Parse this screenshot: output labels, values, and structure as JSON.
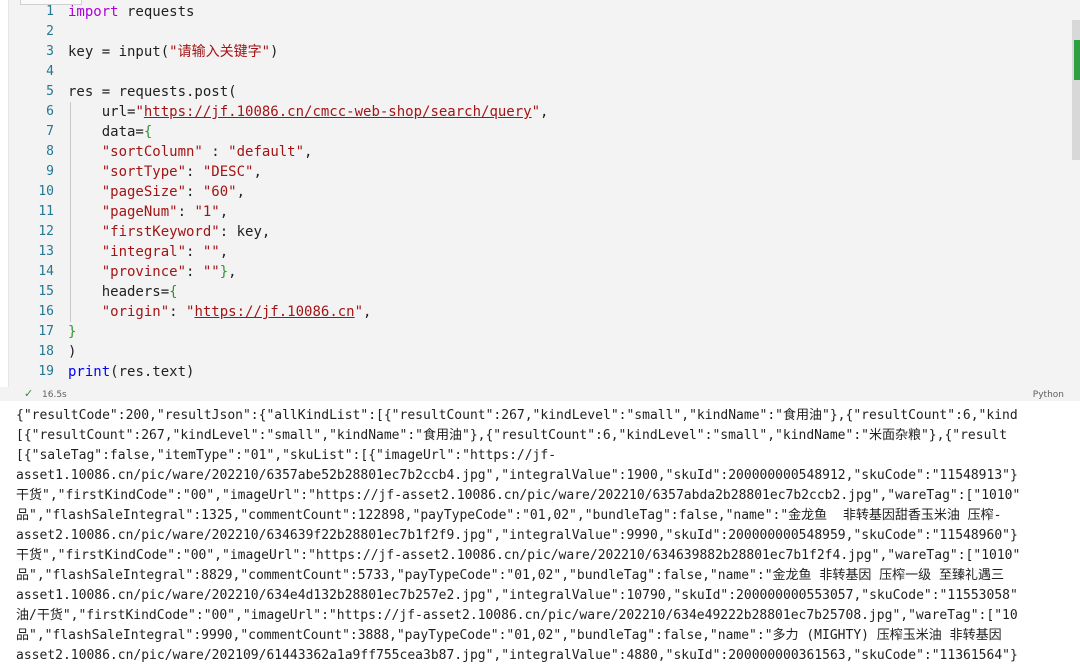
{
  "code_lines": [
    {
      "n": "1",
      "tokens": [
        {
          "t": "import",
          "c": "kw2"
        },
        {
          "t": " requests",
          "c": ""
        }
      ]
    },
    {
      "n": "2",
      "tokens": []
    },
    {
      "n": "3",
      "tokens": [
        {
          "t": "key = input(",
          "c": ""
        },
        {
          "t": "\"请输入关键字\"",
          "c": "str"
        },
        {
          "t": ")",
          "c": ""
        }
      ]
    },
    {
      "n": "4",
      "tokens": []
    },
    {
      "n": "5",
      "tokens": [
        {
          "t": "res = requests.post(",
          "c": ""
        }
      ]
    },
    {
      "n": "6",
      "tokens": [
        {
          "t": "    url=",
          "c": ""
        },
        {
          "t": "\"",
          "c": "str"
        },
        {
          "t": "https://jf.10086.cn/cmcc-web-shop/search/query",
          "c": "str link"
        },
        {
          "t": "\"",
          "c": "str"
        },
        {
          "t": ",",
          "c": ""
        }
      ]
    },
    {
      "n": "7",
      "tokens": [
        {
          "t": "    data=",
          "c": ""
        },
        {
          "t": "{",
          "c": "br2"
        }
      ]
    },
    {
      "n": "8",
      "tokens": [
        {
          "t": "    ",
          "c": ""
        },
        {
          "t": "\"sortColumn\"",
          "c": "str"
        },
        {
          "t": " : ",
          "c": ""
        },
        {
          "t": "\"default\"",
          "c": "str"
        },
        {
          "t": ",",
          "c": ""
        }
      ]
    },
    {
      "n": "9",
      "tokens": [
        {
          "t": "    ",
          "c": ""
        },
        {
          "t": "\"sortType\"",
          "c": "str"
        },
        {
          "t": ": ",
          "c": ""
        },
        {
          "t": "\"DESC\"",
          "c": "str"
        },
        {
          "t": ",",
          "c": ""
        }
      ]
    },
    {
      "n": "10",
      "tokens": [
        {
          "t": "    ",
          "c": ""
        },
        {
          "t": "\"pageSize\"",
          "c": "str"
        },
        {
          "t": ": ",
          "c": ""
        },
        {
          "t": "\"60\"",
          "c": "str"
        },
        {
          "t": ",",
          "c": ""
        }
      ]
    },
    {
      "n": "11",
      "tokens": [
        {
          "t": "    ",
          "c": ""
        },
        {
          "t": "\"pageNum\"",
          "c": "str"
        },
        {
          "t": ": ",
          "c": ""
        },
        {
          "t": "\"1\"",
          "c": "str"
        },
        {
          "t": ",",
          "c": ""
        }
      ]
    },
    {
      "n": "12",
      "tokens": [
        {
          "t": "    ",
          "c": ""
        },
        {
          "t": "\"firstKeyword\"",
          "c": "str"
        },
        {
          "t": ": key,",
          "c": ""
        }
      ]
    },
    {
      "n": "13",
      "tokens": [
        {
          "t": "    ",
          "c": ""
        },
        {
          "t": "\"integral\"",
          "c": "str"
        },
        {
          "t": ": ",
          "c": ""
        },
        {
          "t": "\"\"",
          "c": "str"
        },
        {
          "t": ",",
          "c": ""
        }
      ]
    },
    {
      "n": "14",
      "tokens": [
        {
          "t": "    ",
          "c": ""
        },
        {
          "t": "\"province\"",
          "c": "str"
        },
        {
          "t": ": ",
          "c": ""
        },
        {
          "t": "\"\"",
          "c": "str"
        },
        {
          "t": "}",
          "c": "br2"
        },
        {
          "t": ",",
          "c": ""
        }
      ]
    },
    {
      "n": "15",
      "tokens": [
        {
          "t": "    headers=",
          "c": ""
        },
        {
          "t": "{",
          "c": "br2"
        }
      ]
    },
    {
      "n": "16",
      "tokens": [
        {
          "t": "    ",
          "c": ""
        },
        {
          "t": "\"origin\"",
          "c": "str"
        },
        {
          "t": ": ",
          "c": ""
        },
        {
          "t": "\"",
          "c": "str"
        },
        {
          "t": "https://jf.10086.cn",
          "c": "str link"
        },
        {
          "t": "\"",
          "c": "str"
        },
        {
          "t": ",",
          "c": ""
        }
      ]
    },
    {
      "n": "17",
      "tokens": [
        {
          "t": "}",
          "c": "br2"
        }
      ]
    },
    {
      "n": "18",
      "tokens": [
        {
          "t": ")",
          "c": ""
        }
      ]
    },
    {
      "n": "19",
      "tokens": [
        {
          "t": "print",
          "c": "kw"
        },
        {
          "t": "(res.text)",
          "c": ""
        }
      ]
    }
  ],
  "status": {
    "check": "✓",
    "time": "16.5s",
    "language": "Python"
  },
  "output_lines": [
    "{\"resultCode\":200,\"resultJson\":{\"allKindList\":[{\"resultCount\":267,\"kindLevel\":\"small\",\"kindName\":\"食用油\"},{\"resultCount\":6,\"kind",
    "[{\"resultCount\":267,\"kindLevel\":\"small\",\"kindName\":\"食用油\"},{\"resultCount\":6,\"kindLevel\":\"small\",\"kindName\":\"米面杂粮\"},{\"result",
    "[{\"saleTag\":false,\"itemType\":\"01\",\"skuList\":[{\"imageUrl\":\"https://jf-",
    "asset1.10086.cn/pic/ware/202210/6357abe52b28801ec7b2ccb4.jpg\",\"integralValue\":1900,\"skuId\":200000000548912,\"skuCode\":\"11548913\"}",
    "干货\",\"firstKindCode\":\"00\",\"imageUrl\":\"https://jf-asset2.10086.cn/pic/ware/202210/6357abda2b28801ec7b2ccb2.jpg\",\"wareTag\":[\"1010\"",
    "品\",\"flashSaleIntegral\":1325,\"commentCount\":122898,\"payTypeCode\":\"01,02\",\"bundleTag\":false,\"name\":\"金龙鱼  非转基因甜香玉米油 压榨-",
    "asset2.10086.cn/pic/ware/202210/634639f22b28801ec7b1f2f9.jpg\",\"integralValue\":9990,\"skuId\":200000000548959,\"skuCode\":\"11548960\"}",
    "干货\",\"firstKindCode\":\"00\",\"imageUrl\":\"https://jf-asset2.10086.cn/pic/ware/202210/634639882b28801ec7b1f2f4.jpg\",\"wareTag\":[\"1010\"",
    "品\",\"flashSaleIntegral\":8829,\"commentCount\":5733,\"payTypeCode\":\"01,02\",\"bundleTag\":false,\"name\":\"金龙鱼 非转基因 压榨一级 至臻礼遇三",
    "asset1.10086.cn/pic/ware/202210/634e4d132b28801ec7b257e2.jpg\",\"integralValue\":10790,\"skuId\":200000000553057,\"skuCode\":\"11553058\"",
    "油/干货\",\"firstKindCode\":\"00\",\"imageUrl\":\"https://jf-asset2.10086.cn/pic/ware/202210/634e49222b28801ec7b25708.jpg\",\"wareTag\":[\"10",
    "品\",\"flashSaleIntegral\":9990,\"commentCount\":3888,\"payTypeCode\":\"01,02\",\"bundleTag\":false,\"name\":\"多力 (MIGHTY) 压榨玉米油 非转基因",
    "asset2.10086.cn/pic/ware/202109/61443362a1a9ff755cea3b87.jpg\",\"integralValue\":4880,\"skuId\":200000000361563,\"skuCode\":\"11361564\"}"
  ]
}
